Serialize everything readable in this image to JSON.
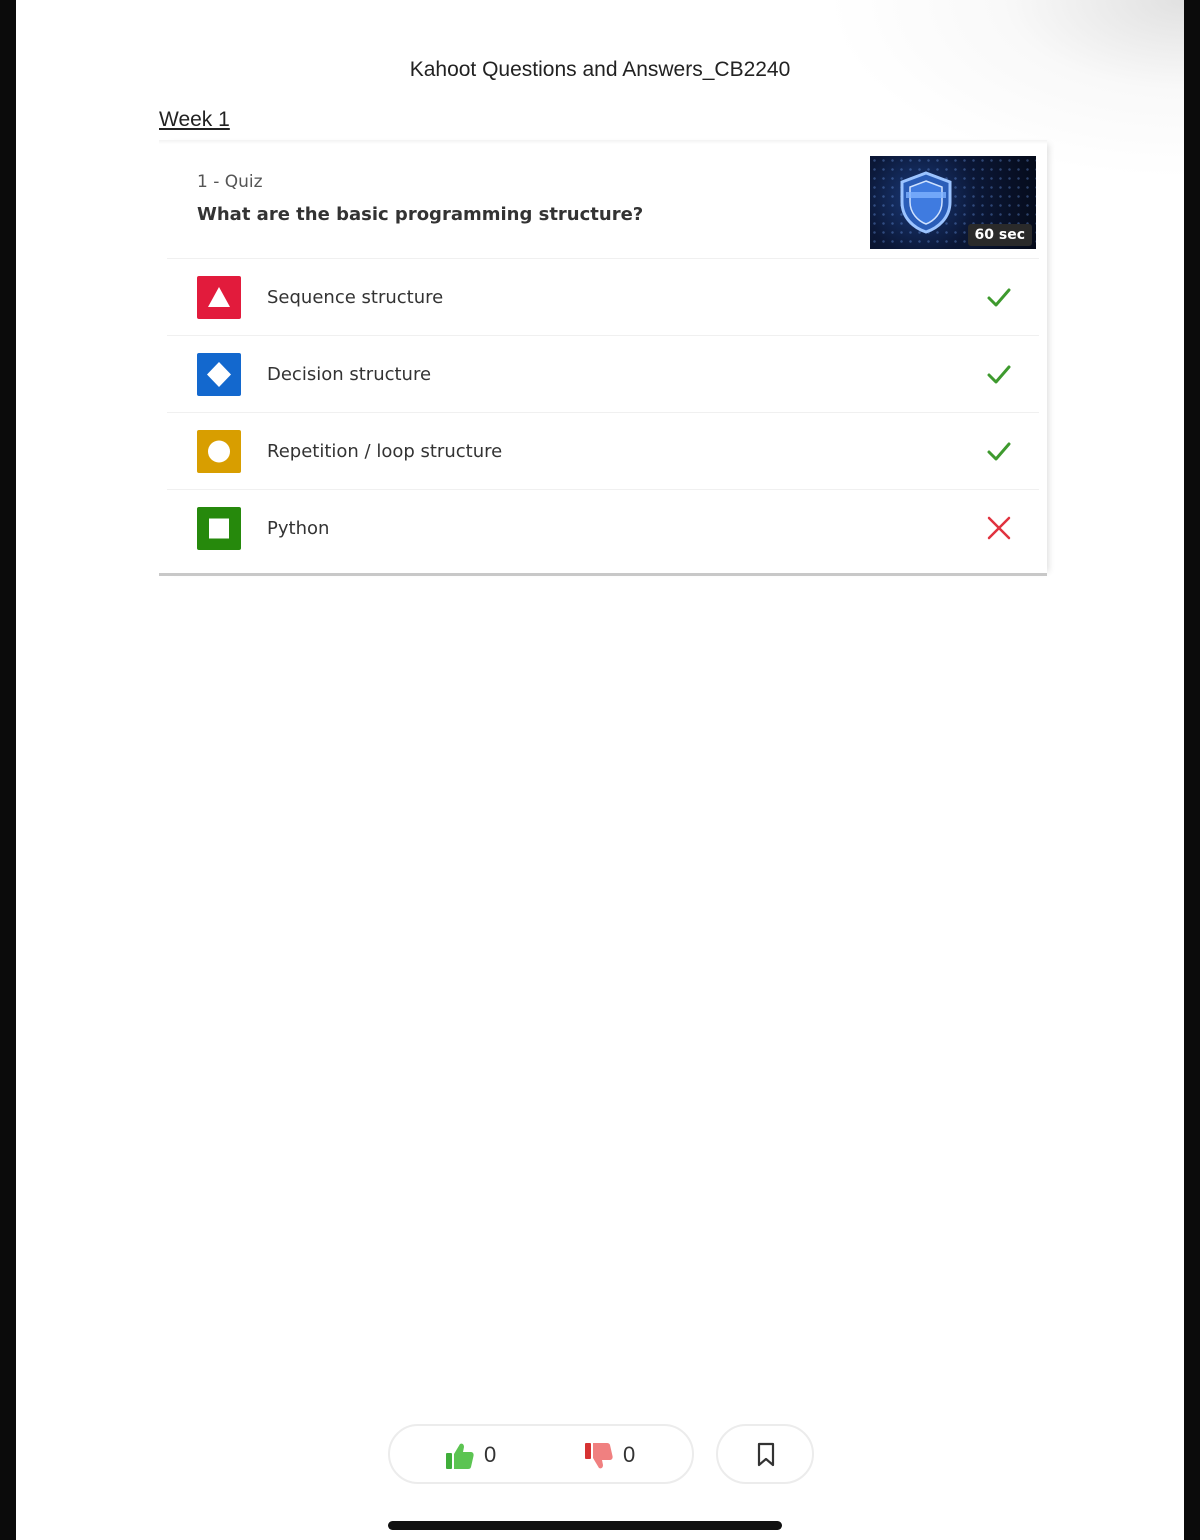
{
  "document": {
    "title": "Kahoot Questions and Answers_CB2240",
    "section": "Week 1"
  },
  "question": {
    "label": "1 - Quiz",
    "text": "What are the basic programming structure?",
    "time_limit": "60 sec",
    "answers": [
      {
        "shape": "triangle",
        "color": "#e21b3c",
        "text": "Sequence structure",
        "correct": true
      },
      {
        "shape": "diamond",
        "color": "#1368ce",
        "text": "Decision structure",
        "correct": true
      },
      {
        "shape": "circle",
        "color": "#d89e00",
        "text": "Repetition / loop structure",
        "correct": true
      },
      {
        "shape": "square",
        "color": "#26890c",
        "text": "Python",
        "correct": false
      }
    ]
  },
  "reactions": {
    "likes": "0",
    "dislikes": "0"
  },
  "colors": {
    "correct": "#3e9a2e",
    "incorrect": "#e0323f"
  }
}
